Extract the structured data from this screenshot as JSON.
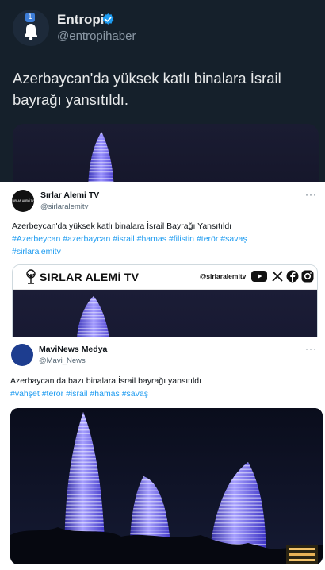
{
  "tweet_top": {
    "name": "Entropi",
    "handle": "@entropihaber",
    "notification_count": "1",
    "text": "Azerbaycan'da yüksek katlı binalara İsrail bayrağı yansıtıldı."
  },
  "tweet_middle": {
    "name": "Sırlar Alemi TV",
    "handle": "@sirlaralemitv",
    "text": "Azerbeycan'da yüksek katlı binalara İsrail Bayrağı Yansıtıldı",
    "hashtags": [
      "#Azerbeycan",
      "#azerbaycan",
      "#israil",
      "#hamas",
      "#filistin",
      "#terör",
      "#savaş",
      "#sirlaralemitv"
    ],
    "banner": {
      "brand": "SIRLAR ALEMİ TV",
      "handle": "@sirlaralemitv",
      "social_icons": [
        "youtube-icon",
        "x-icon",
        "facebook-icon",
        "instagram-icon"
      ]
    }
  },
  "tweet_bottom": {
    "name": "MaviNews Medya",
    "handle": "@Mavi_News",
    "text": "Azerbaycan da bazı binalara İsrail bayrağı yansıtıldı",
    "hashtags": [
      "#vahşet",
      "#terör",
      "#israil",
      "#hamas",
      "#savaş"
    ]
  },
  "colors": {
    "dark_bg": "#15202b",
    "link_blue": "#1d9bf0",
    "tower_light": "#8f86ff"
  }
}
